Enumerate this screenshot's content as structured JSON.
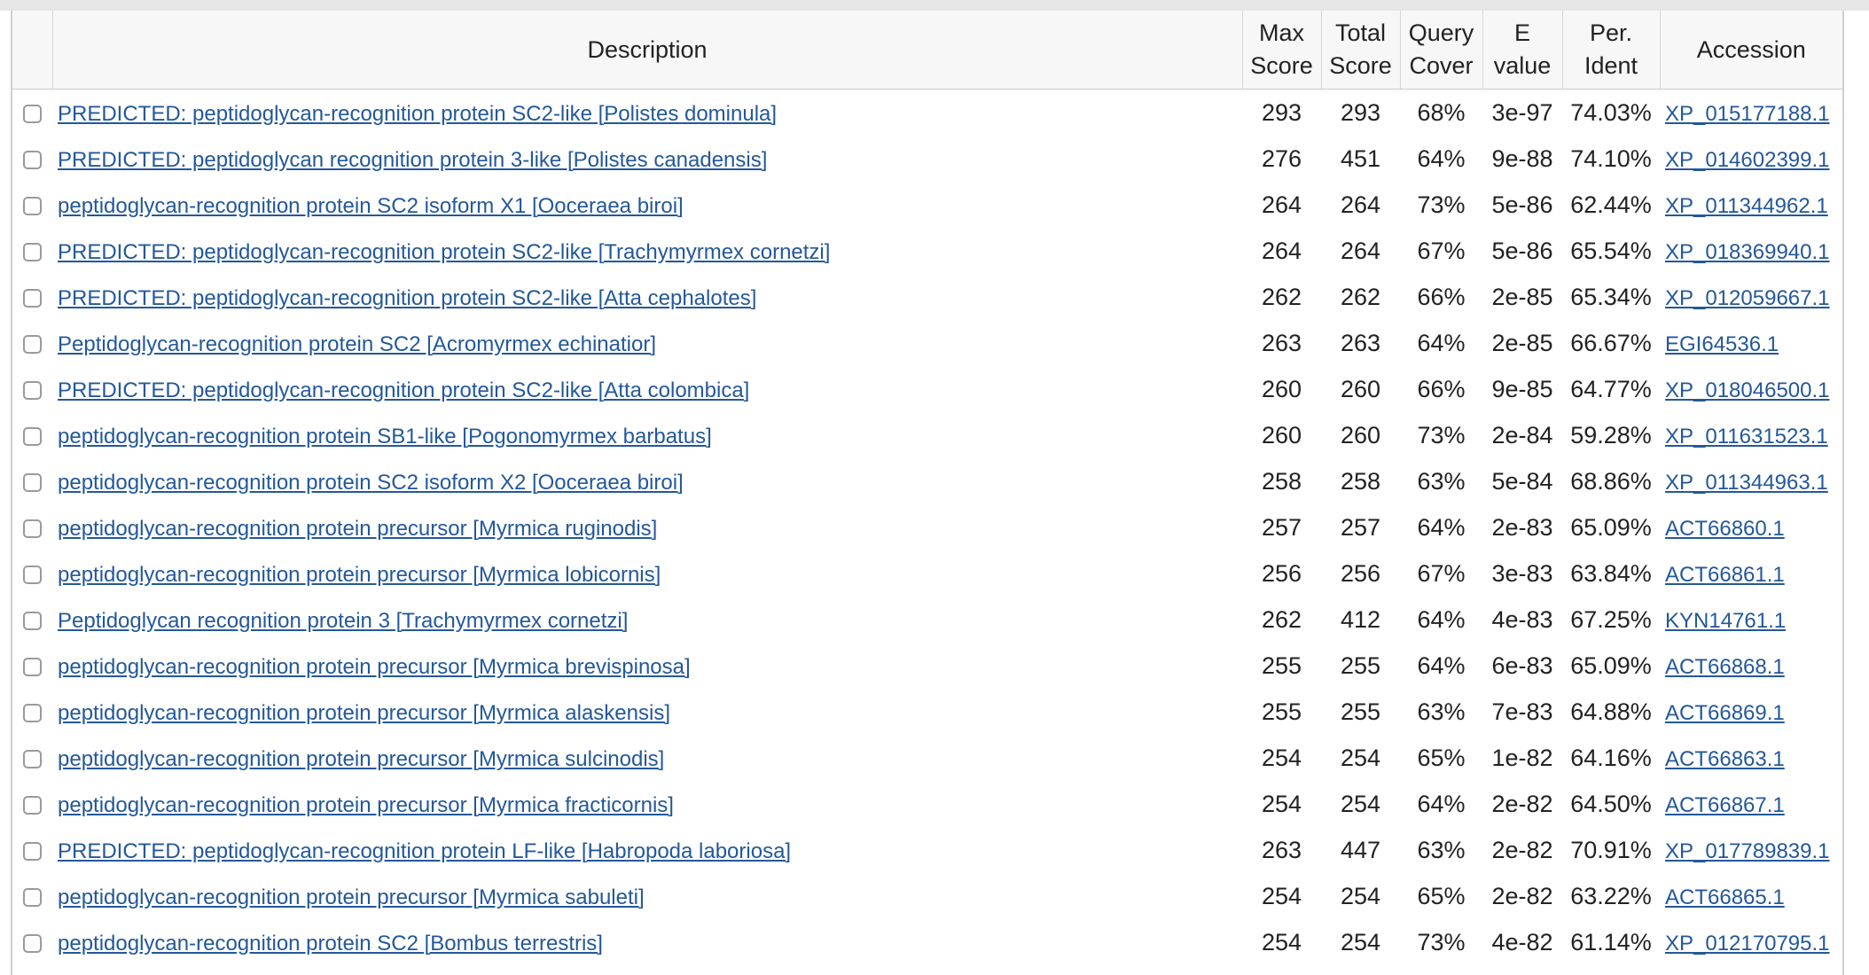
{
  "columns": {
    "description": "Description",
    "max_score": [
      "Max",
      "Score"
    ],
    "total_score": [
      "Total",
      "Score"
    ],
    "query_cover": [
      "Query",
      "Cover"
    ],
    "e_value": [
      "E",
      "value"
    ],
    "per_ident": [
      "Per.",
      "Ident"
    ],
    "accession": "Accession"
  },
  "rows": [
    {
      "description": "PREDICTED: peptidoglycan-recognition protein SC2-like [Polistes dominula]",
      "max_score": "293",
      "total_score": "293",
      "query_cover": "68%",
      "e_value": "3e-97",
      "per_ident": "74.03%",
      "accession": "XP_015177188.1"
    },
    {
      "description": "PREDICTED: peptidoglycan recognition protein 3-like [Polistes canadensis]",
      "max_score": "276",
      "total_score": "451",
      "query_cover": "64%",
      "e_value": "9e-88",
      "per_ident": "74.10%",
      "accession": "XP_014602399.1"
    },
    {
      "description": "peptidoglycan-recognition protein SC2 isoform X1 [Ooceraea biroi]",
      "max_score": "264",
      "total_score": "264",
      "query_cover": "73%",
      "e_value": "5e-86",
      "per_ident": "62.44%",
      "accession": "XP_011344962.1"
    },
    {
      "description": "PREDICTED: peptidoglycan-recognition protein SC2-like [Trachymyrmex cornetzi]",
      "max_score": "264",
      "total_score": "264",
      "query_cover": "67%",
      "e_value": "5e-86",
      "per_ident": "65.54%",
      "accession": "XP_018369940.1"
    },
    {
      "description": "PREDICTED: peptidoglycan-recognition protein SC2-like [Atta cephalotes]",
      "max_score": "262",
      "total_score": "262",
      "query_cover": "66%",
      "e_value": "2e-85",
      "per_ident": "65.34%",
      "accession": "XP_012059667.1"
    },
    {
      "description": "Peptidoglycan-recognition protein SC2 [Acromyrmex echinatior]",
      "max_score": "263",
      "total_score": "263",
      "query_cover": "64%",
      "e_value": "2e-85",
      "per_ident": "66.67%",
      "accession": "EGI64536.1"
    },
    {
      "description": "PREDICTED: peptidoglycan-recognition protein SC2-like [Atta colombica]",
      "max_score": "260",
      "total_score": "260",
      "query_cover": "66%",
      "e_value": "9e-85",
      "per_ident": "64.77%",
      "accession": "XP_018046500.1"
    },
    {
      "description": "peptidoglycan-recognition protein SB1-like [Pogonomyrmex barbatus]",
      "max_score": "260",
      "total_score": "260",
      "query_cover": "73%",
      "e_value": "2e-84",
      "per_ident": "59.28%",
      "accession": "XP_011631523.1"
    },
    {
      "description": "peptidoglycan-recognition protein SC2 isoform X2 [Ooceraea biroi]",
      "max_score": "258",
      "total_score": "258",
      "query_cover": "63%",
      "e_value": "5e-84",
      "per_ident": "68.86%",
      "accession": "XP_011344963.1"
    },
    {
      "description": "peptidoglycan-recognition protein precursor [Myrmica ruginodis]",
      "max_score": "257",
      "total_score": "257",
      "query_cover": "64%",
      "e_value": "2e-83",
      "per_ident": "65.09%",
      "accession": "ACT66860.1"
    },
    {
      "description": "peptidoglycan-recognition protein precursor [Myrmica lobicornis]",
      "max_score": "256",
      "total_score": "256",
      "query_cover": "67%",
      "e_value": "3e-83",
      "per_ident": "63.84%",
      "accession": "ACT66861.1"
    },
    {
      "description": "Peptidoglycan recognition protein 3 [Trachymyrmex cornetzi]",
      "max_score": "262",
      "total_score": "412",
      "query_cover": "64%",
      "e_value": "4e-83",
      "per_ident": "67.25%",
      "accession": "KYN14761.1"
    },
    {
      "description": "peptidoglycan-recognition protein precursor [Myrmica brevispinosa]",
      "max_score": "255",
      "total_score": "255",
      "query_cover": "64%",
      "e_value": "6e-83",
      "per_ident": "65.09%",
      "accession": "ACT66868.1"
    },
    {
      "description": "peptidoglycan-recognition protein precursor [Myrmica alaskensis]",
      "max_score": "255",
      "total_score": "255",
      "query_cover": "63%",
      "e_value": "7e-83",
      "per_ident": "64.88%",
      "accession": "ACT66869.1"
    },
    {
      "description": "peptidoglycan-recognition protein precursor [Myrmica sulcinodis]",
      "max_score": "254",
      "total_score": "254",
      "query_cover": "65%",
      "e_value": "1e-82",
      "per_ident": "64.16%",
      "accession": "ACT66863.1"
    },
    {
      "description": "peptidoglycan-recognition protein precursor [Myrmica fracticornis]",
      "max_score": "254",
      "total_score": "254",
      "query_cover": "64%",
      "e_value": "2e-82",
      "per_ident": "64.50%",
      "accession": "ACT66867.1"
    },
    {
      "description": "PREDICTED: peptidoglycan-recognition protein LF-like [Habropoda laboriosa]",
      "max_score": "263",
      "total_score": "447",
      "query_cover": "63%",
      "e_value": "2e-82",
      "per_ident": "70.91%",
      "accession": "XP_017789839.1"
    },
    {
      "description": "peptidoglycan-recognition protein precursor [Myrmica sabuleti]",
      "max_score": "254",
      "total_score": "254",
      "query_cover": "65%",
      "e_value": "2e-82",
      "per_ident": "63.22%",
      "accession": "ACT66865.1"
    },
    {
      "description": "peptidoglycan-recognition protein SC2 [Bombus terrestris]",
      "max_score": "254",
      "total_score": "254",
      "query_cover": "73%",
      "e_value": "4e-82",
      "per_ident": "61.14%",
      "accession": "XP_012170795.1"
    }
  ]
}
